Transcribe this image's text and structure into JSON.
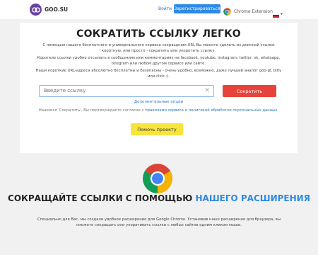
{
  "header": {
    "brand": "GOO.SU",
    "login": "Войти",
    "register": "Зарегистрироваться",
    "chrome_extension": "Chrome Extension"
  },
  "main": {
    "title": "СОКРАТИТЬ ССЫЛКУ ЛЕГКО",
    "para1": "С помощью нашего бесплатного и универсального сервиса сокращения URL Вы можете сделать из длинной ссылки короткую, или просто - сократить или укоротить ссылку.",
    "para2": "Короткие ссылки удобно отсылать в сообщениях или комментариях на facebook, youtube, instagram, twitter, vk, whatsapp, telegram или любом другом сервисе или сайте.",
    "para3": "Наши короткие URL-адреса абсолютно бесплатны и безопасны - очень удобно, возможно, даже лучший аналог goo-gl, bitly или click :).",
    "input_placeholder": "Введите ссылку",
    "shorten_button": "Сократить",
    "more_options": "Дополнительные опции",
    "agree_prefix": "Нажимая 'Сократить', Вы подтверждаете согласие с",
    "terms_link": "правилами сервиса",
    "agree_and": "и",
    "privacy_link": "политикой обработки персональных данных",
    "agree_suffix": ".",
    "help_button": "Помочь проекту"
  },
  "extension": {
    "title_part1": "СОКРАЩАЙТЕ ССЫЛКИ С ПОМОЩЬЮ",
    "title_highlight": "НАШЕГО РАСШИРЕНИЯ",
    "description": "Специально для Вас, мы создали удобное расширение для Google Chrome. Установив наше расширение для браузера, вы сможете сокращать или укорачивать ссылки с любых сайтов одним кликом мыши."
  },
  "colors": {
    "accent_blue": "#2d8ae6",
    "shorten_red": "#e8433b",
    "help_yellow": "#f7e53c",
    "brand_purple": "#6b3fa0"
  }
}
